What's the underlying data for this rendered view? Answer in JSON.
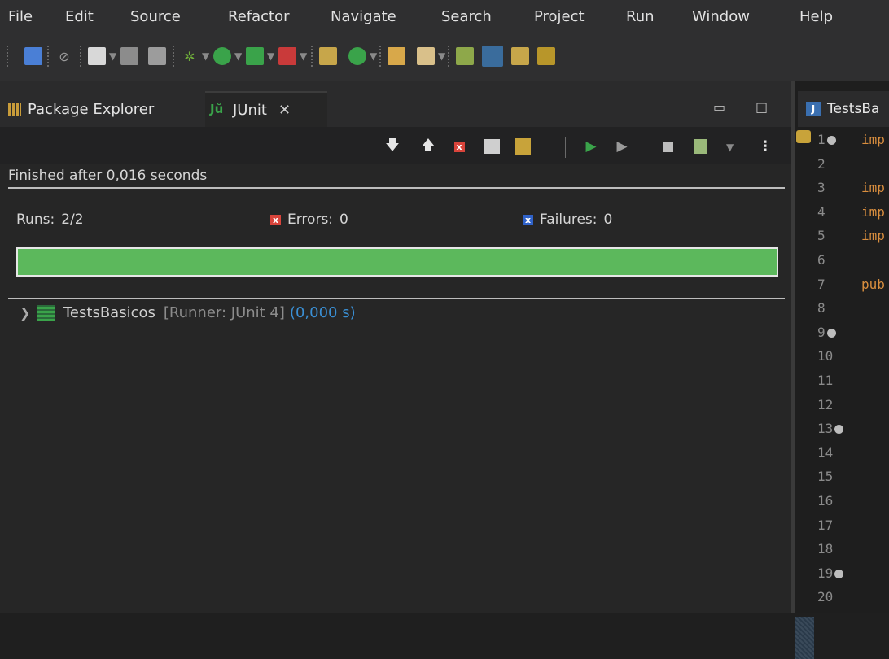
{
  "menu": [
    "File",
    "Edit",
    "Source",
    "Refactor",
    "Navigate",
    "Search",
    "Project",
    "Run",
    "Window",
    "Help"
  ],
  "tabs": {
    "package_explorer": "Package Explorer",
    "junit": "JUnit",
    "close_glyph": "✕"
  },
  "junit": {
    "status": "Finished after 0,016 seconds",
    "runs_label": "Runs:",
    "runs_value": "2/2",
    "errors_label": "Errors:",
    "errors_value": "0",
    "failures_label": "Failures:",
    "failures_value": "0",
    "progress": 1.0,
    "progress_color": "#5cb85c",
    "tree": {
      "name": "TestsBasicos",
      "runner": "[Runner: JUnit 4]",
      "time": "(0,000 s)"
    }
  },
  "editor": {
    "tab_label": "TestsBa",
    "lines": [
      "1",
      "2",
      "3",
      "4",
      "5",
      "6",
      "7",
      "8",
      "9",
      "10",
      "11",
      "12",
      "13",
      "14",
      "15",
      "16",
      "17",
      "18",
      "19",
      "20"
    ],
    "code": {
      "1": "imp",
      "3": "imp",
      "4": "imp",
      "5": "imp",
      "7": "pub"
    },
    "folded_lines": [
      "1",
      "9",
      "13",
      "19"
    ]
  },
  "colors": {
    "accent_blue": "#3a8fd4",
    "error_red": "#d9443b",
    "failure_blue": "#2f62c9",
    "keyword_orange": "#d98e3e"
  }
}
